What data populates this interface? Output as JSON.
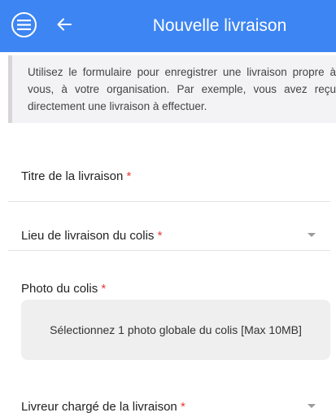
{
  "header": {
    "title": "Nouvelle livraison",
    "menu_icon": "menu-icon",
    "back_icon": "arrow-back-icon",
    "background_color": "#3d85f2"
  },
  "note": {
    "text": "Utilisez le formulaire pour enregistrer une livraison propre à vous, à votre organisation. Par exemple, vous avez reçu directement une livraison à effectuer."
  },
  "form": {
    "title_label": "Titre de la livraison",
    "location_label": "Lieu de livraison du colis",
    "photo_label": "Photo du colis",
    "photo_placeholder": "Sélectionnez 1 photo globale du colis [Max 10MB]",
    "driver_label": "Livreur chargé de la livraison",
    "required_marker": "*"
  }
}
